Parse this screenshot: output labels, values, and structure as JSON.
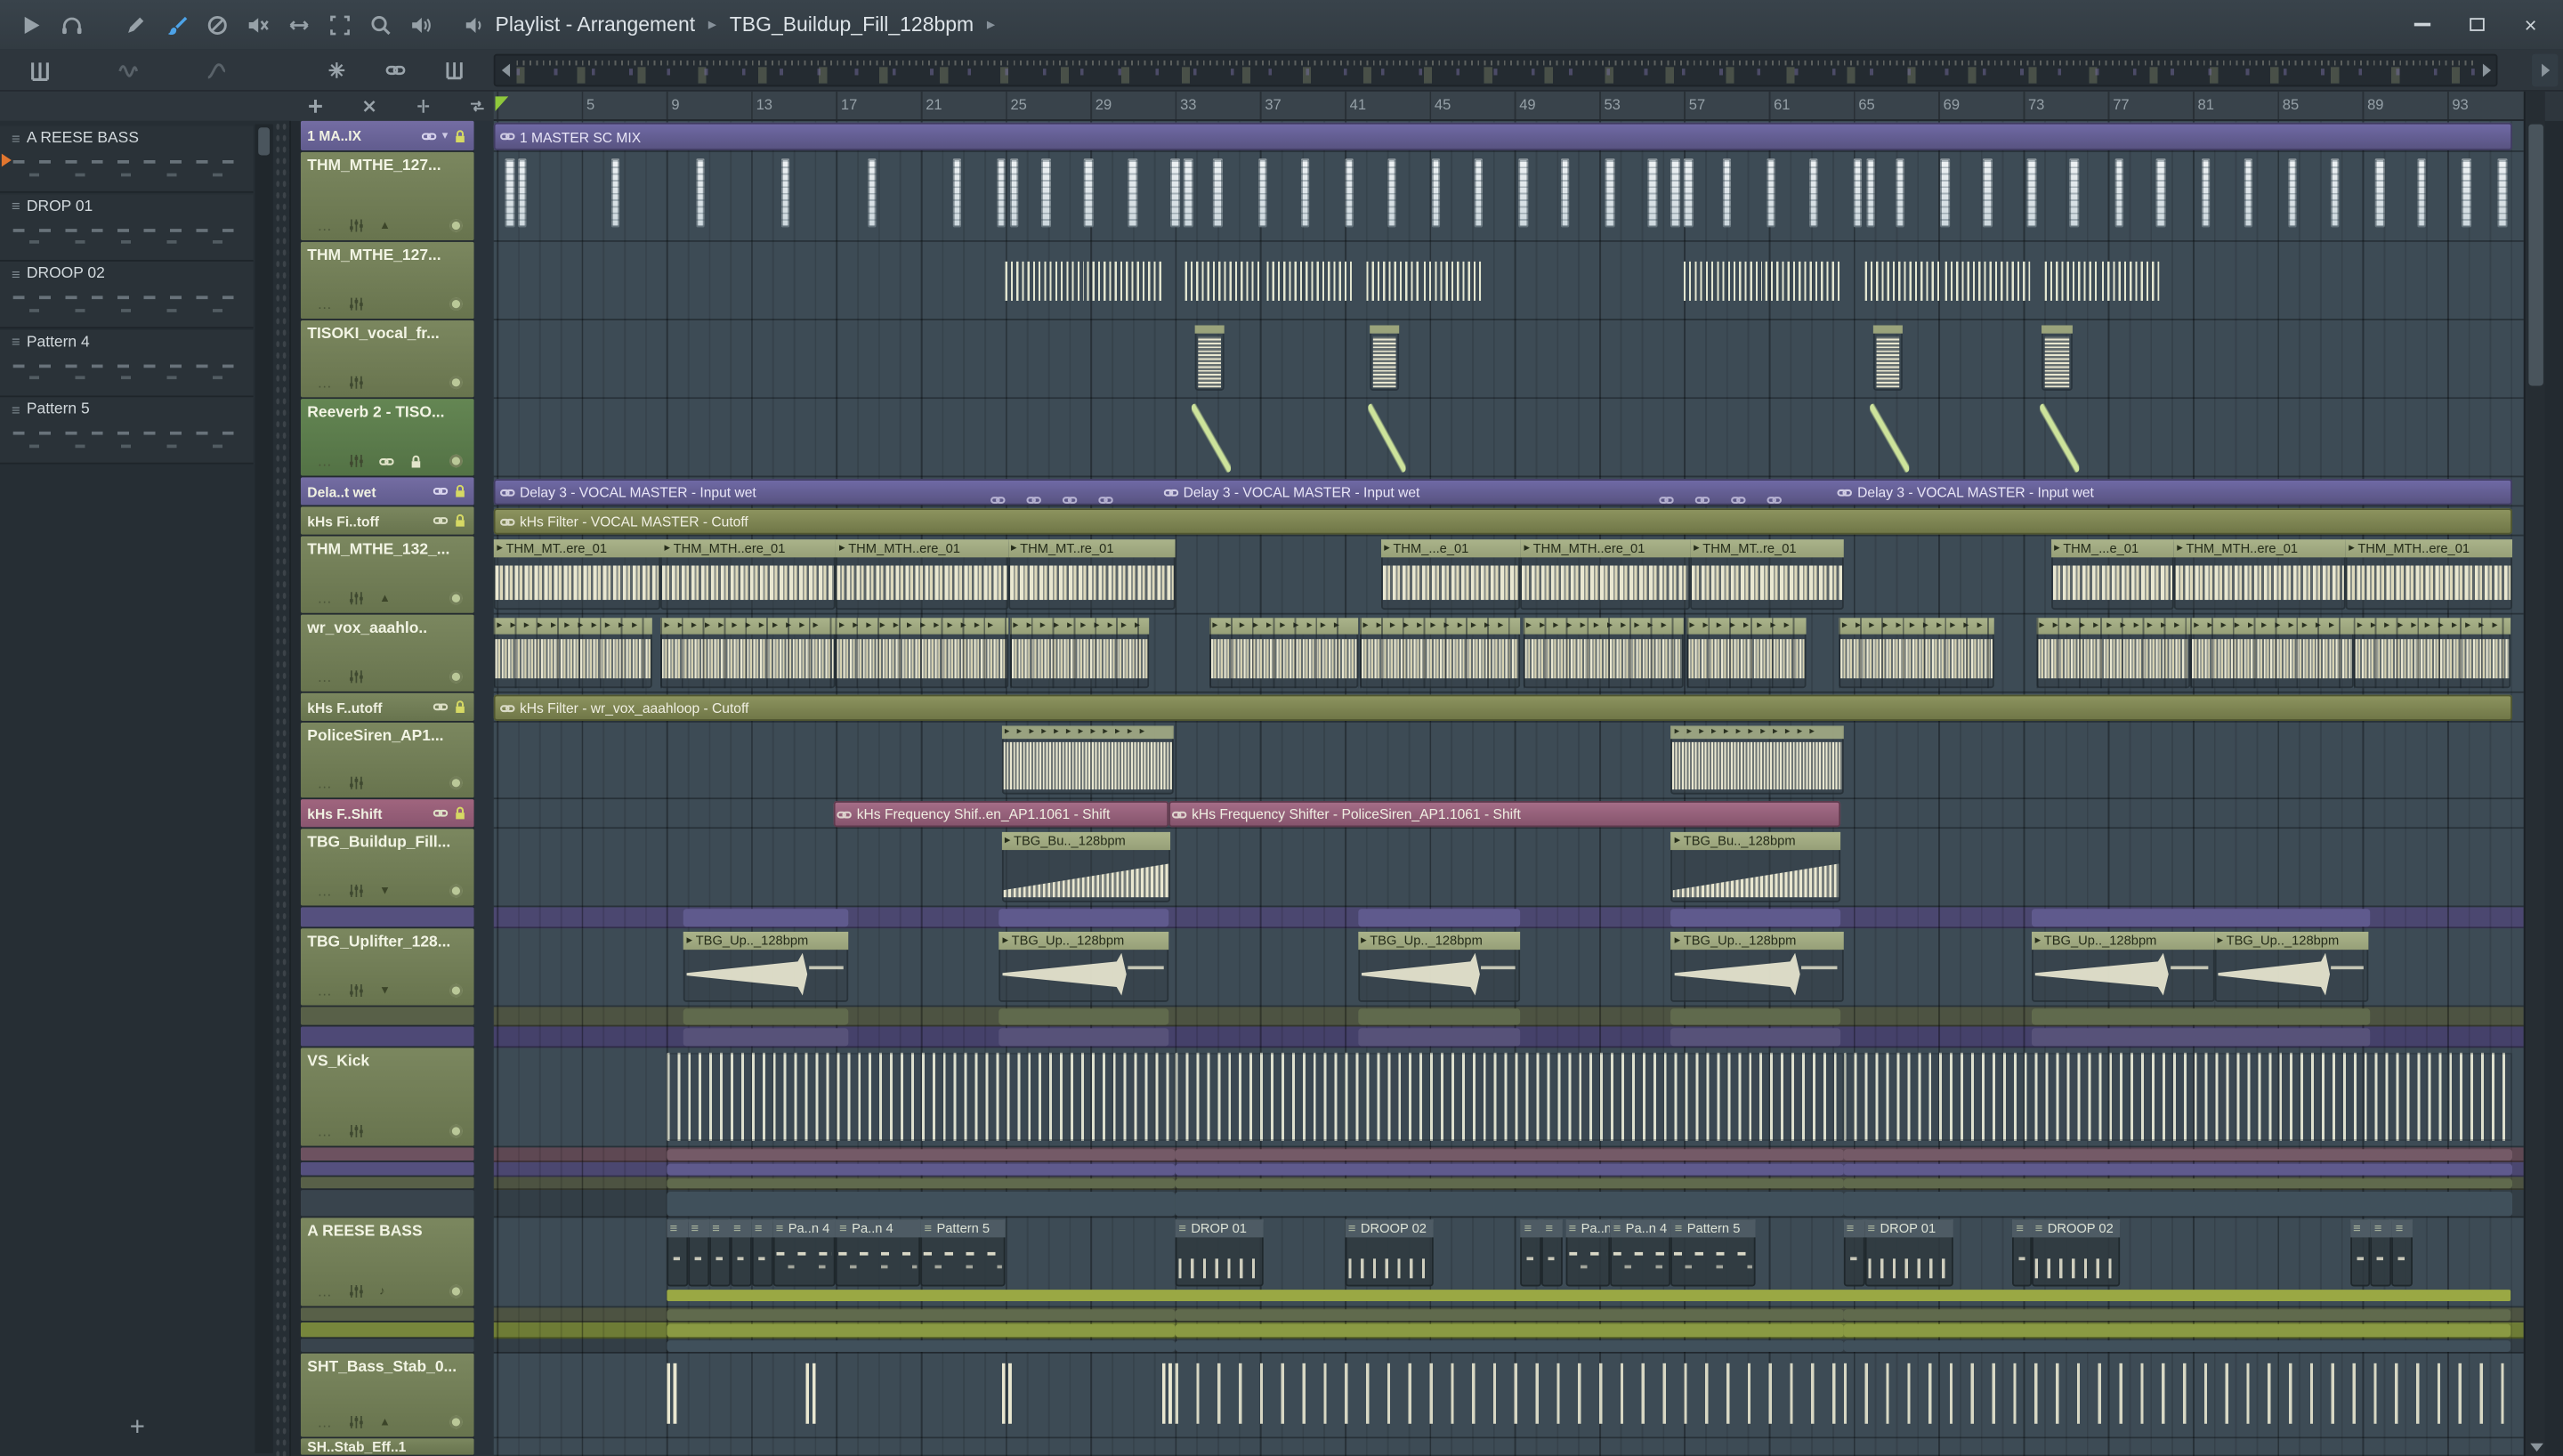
{
  "titlebar": {
    "breadcrumb": [
      "Playlist - Arrangement",
      "TBG_Buildup_Fill_128bpm"
    ],
    "tools": [
      "play",
      "headphones",
      "draw",
      "paint",
      "delete",
      "mute",
      "slide",
      "select",
      "zoom",
      "playback",
      "monitor"
    ],
    "window_controls": [
      "minimize",
      "maximize",
      "close"
    ]
  },
  "picker": {
    "items": [
      "A REESE BASS",
      "DROP 01",
      "DROOP 02",
      "Pattern 4",
      "Pattern 5"
    ],
    "active_index": 0,
    "add_button": "+"
  },
  "playlist_tools": {
    "row1": [
      "smart-find",
      "link",
      "track-mode"
    ],
    "row2": [
      "add",
      "delete",
      "slip",
      "swap"
    ]
  },
  "ruler": {
    "bar_numbers": [
      5,
      9,
      13,
      17,
      21,
      25,
      29,
      33,
      37,
      41,
      45,
      49,
      53,
      57,
      61,
      65,
      69,
      73,
      77,
      81,
      85,
      89,
      93
    ]
  },
  "tracks": [
    {
      "name": "1 MA..IX",
      "color": "purple",
      "h": 19,
      "small": true,
      "icons": [
        "link",
        "dropdown",
        "lock"
      ]
    },
    {
      "name": "THM_MTHE_127...",
      "color": "olive",
      "h": 55,
      "extra": "up"
    },
    {
      "name": "THM_MTHE_127...",
      "color": "olive",
      "h": 48
    },
    {
      "name": "TISOKI_vocal_fr...",
      "color": "olive",
      "h": 48
    },
    {
      "name": "Reeverb 2 - TISO...",
      "color": "green",
      "h": 48,
      "icons": [
        "link",
        "lock"
      ]
    },
    {
      "name": "Dela..t wet",
      "color": "purple",
      "h": 18,
      "small": true,
      "icons": [
        "link",
        "lock"
      ]
    },
    {
      "name": "kHs Fi..toff",
      "color": "olive",
      "h": 18,
      "small": true,
      "icons": [
        "link",
        "lock"
      ]
    },
    {
      "name": "THM_MTHE_132_...",
      "color": "olive",
      "h": 48,
      "extra": "up"
    },
    {
      "name": "wr_vox_aaahlo..",
      "color": "olive",
      "h": 48
    },
    {
      "name": "kHs F..utoff",
      "color": "olive",
      "h": 18,
      "small": true,
      "icons": [
        "link",
        "lock"
      ]
    },
    {
      "name": "PoliceSiren_AP1...",
      "color": "olive",
      "h": 47
    },
    {
      "name": "kHs F..Shift",
      "color": "pink",
      "h": 18,
      "small": true,
      "icons": [
        "link",
        "lock"
      ]
    },
    {
      "name": "TBG_Buildup_Fill...",
      "color": "olive",
      "h": 48,
      "extra": "down"
    },
    {
      "band": "purpleband",
      "h": 13
    },
    {
      "name": "TBG_Uplifter_128...",
      "color": "olive",
      "h": 48,
      "extra": "down"
    },
    {
      "band": "oliveband",
      "h": 12
    },
    {
      "band": "purpleband2",
      "h": 13
    },
    {
      "name": "VS_Kick",
      "color": "olive",
      "h": 61
    },
    {
      "band": "pinkband",
      "h": 9
    },
    {
      "band": "purpleband",
      "h": 9
    },
    {
      "band": "oliveband",
      "h": 8
    },
    {
      "band": "darkband",
      "h": 17
    },
    {
      "name": "A REESE BASS",
      "color": "olive",
      "h": 55,
      "extra": "note"
    },
    {
      "band": "oliveband",
      "h": 9
    },
    {
      "band": "limerow",
      "h": 10
    },
    {
      "band": "darkband",
      "h": 9
    },
    {
      "name": "SHT_Bass_Stab_0...",
      "color": "olive",
      "h": 52,
      "extra": "up"
    },
    {
      "name": "SH..Stab_Eff..1",
      "color": "olive",
      "h": 11,
      "small": true
    }
  ],
  "clips": [
    {
      "kind": "strip",
      "track": 0,
      "tone": "purple",
      "start": 0.85,
      "len": 95.25,
      "labels": [
        {
          "bar": 1.0,
          "text": "1 MASTER SC MIX"
        }
      ]
    },
    {
      "kind": "vset",
      "track": 1,
      "len": 0.42,
      "bars": [
        1.4,
        2.0,
        6.4,
        10.4,
        14.4,
        18.5,
        22.5,
        24.6,
        25.2,
        26.7,
        28.7,
        30.8,
        32.8,
        33.4,
        34.8,
        36.9,
        38.9,
        41.0,
        43.0,
        45.1,
        47.1,
        49.2,
        51.2,
        53.3,
        55.3,
        56.4,
        57.0,
        58.8,
        60.9,
        62.9,
        65.0,
        65.6,
        67.0,
        69.1,
        71.1,
        73.2,
        75.2,
        77.3,
        79.3,
        81.4,
        83.4,
        85.5,
        87.5,
        89.6,
        91.6,
        93.7,
        95.4
      ]
    },
    {
      "kind": "combset",
      "track": 2,
      "clips": [
        [
          25,
          3.7
        ],
        [
          28.8,
          3.6
        ],
        [
          33.5,
          3.6
        ],
        [
          37.3,
          4.0
        ],
        [
          42.0,
          2.6
        ],
        [
          44.7,
          2.7
        ],
        [
          57.0,
          3.7
        ],
        [
          60.8,
          3.6
        ],
        [
          65.5,
          3.6
        ],
        [
          69.3,
          4.0
        ],
        [
          74.0,
          2.6
        ],
        [
          76.7,
          2.7
        ]
      ]
    },
    {
      "kind": "oneshot",
      "track": 3,
      "len": 1.4,
      "bars": [
        33.9,
        42.2,
        65.9,
        73.9
      ]
    },
    {
      "kind": "curveset",
      "track": 4,
      "len": 1.8,
      "bars": [
        33.8,
        42.1,
        65.8,
        73.8
      ]
    },
    {
      "kind": "strip",
      "track": 5,
      "tone": "purple",
      "start": 0.85,
      "len": 95.25,
      "labels": [
        {
          "bar": 1.0,
          "text": "Delay 3 - VOCAL MASTER - Input wet"
        },
        {
          "bar": 32.3,
          "text": "Delay 3 - VOCAL MASTER - Input wet"
        },
        {
          "bar": 64.1,
          "text": "Delay 3 - VOCAL MASTER - Input wet"
        }
      ],
      "marks": [
        24.3,
        26.0,
        27.7,
        29.4,
        55.8,
        57.5,
        59.2,
        60.9
      ]
    },
    {
      "kind": "strip",
      "track": 6,
      "tone": "olive",
      "start": 0.85,
      "len": 95.25,
      "labels": [
        {
          "bar": 1.0,
          "text": "kHs Filter - VOCAL MASTER - Cutoff"
        }
      ]
    },
    {
      "kind": "audioset",
      "track": 7,
      "clips": [
        [
          0.85,
          7.9,
          "THM_MT..ere_01"
        ],
        [
          8.75,
          8.25,
          "THM_MTH..ere_01"
        ],
        [
          17.0,
          8.1,
          "THM_MTH..ere_01"
        ],
        [
          25.1,
          7.9,
          "THM_MT..re_01"
        ],
        [
          42.7,
          6.6,
          "THM_...e_01"
        ],
        [
          49.3,
          8.0,
          "THM_MTH..ere_01"
        ],
        [
          57.3,
          7.2,
          "THM_MT..re_01"
        ],
        [
          74.3,
          5.8,
          "THM_...e_01"
        ],
        [
          80.1,
          8.1,
          "THM_MTH..ere_01"
        ],
        [
          88.2,
          7.9,
          "THM_MTH..ere_01"
        ]
      ]
    },
    {
      "kind": "voxset",
      "track": 8,
      "clips": [
        [
          0.85,
          7.5
        ],
        [
          8.75,
          8.25
        ],
        [
          17.0,
          8.1
        ],
        [
          25.2,
          6.6
        ],
        [
          34.6,
          7.0
        ],
        [
          41.7,
          7.6
        ],
        [
          49.4,
          7.6
        ],
        [
          57.1,
          5.7
        ],
        [
          64.3,
          7.3
        ],
        [
          73.6,
          7.3
        ],
        [
          80.9,
          7.7
        ],
        [
          88.6,
          7.4
        ]
      ]
    },
    {
      "kind": "strip",
      "track": 9,
      "tone": "olive",
      "start": 0.85,
      "len": 95.25,
      "labels": [
        {
          "bar": 1.0,
          "text": "kHs Filter - wr_vox_aaahloop - Cutoff"
        }
      ]
    },
    {
      "kind": "policeset",
      "track": 10,
      "clips": [
        [
          24.8,
          8.1
        ],
        [
          56.4,
          8.1
        ]
      ]
    },
    {
      "kind": "pinkset",
      "track": 11,
      "clips": [
        [
          16.9,
          15.8,
          "kHs Frequency Shif..en_AP1.1061 - Shift"
        ],
        [
          32.7,
          31.7,
          "kHs Frequency Shifter - PoliceSiren_AP1.1061 - Shift"
        ]
      ]
    },
    {
      "kind": "buildupset",
      "track": 12,
      "label": "TBG_Bu.._128bpm",
      "clips": [
        [
          24.8,
          8.0
        ],
        [
          56.4,
          8.0
        ]
      ]
    },
    {
      "kind": "miniset",
      "track": 13,
      "clips": [
        [
          9.8,
          7.8
        ],
        [
          24.7,
          8.0
        ],
        [
          41.6,
          7.7
        ],
        [
          56.4,
          8.0
        ],
        [
          73.4,
          16.0
        ]
      ]
    },
    {
      "kind": "uplifterset",
      "track": 14,
      "label": "TBG_Up.._128bpm",
      "clips": [
        [
          9.8,
          7.8
        ],
        [
          24.7,
          8.0
        ],
        [
          41.6,
          7.7
        ],
        [
          56.4,
          8.1
        ],
        [
          73.4,
          8.6
        ],
        [
          82.0,
          7.3
        ]
      ]
    },
    {
      "kind": "miniset",
      "track": 15,
      "clips": [
        [
          9.8,
          7.8
        ],
        [
          24.7,
          8.0
        ],
        [
          41.6,
          7.7
        ],
        [
          56.4,
          8.0
        ],
        [
          73.4,
          16.0
        ]
      ]
    },
    {
      "kind": "miniset",
      "track": 16,
      "clips": [
        [
          9.8,
          7.8
        ],
        [
          24.7,
          8.0
        ],
        [
          41.6,
          7.7
        ],
        [
          56.4,
          8.0
        ],
        [
          73.4,
          16.0
        ]
      ]
    },
    {
      "kind": "kickset",
      "track": 17,
      "clips": [
        [
          9.0,
          24.0
        ],
        [
          33.0,
          31.5
        ],
        [
          64.5,
          31.6
        ]
      ]
    },
    {
      "kind": "miniset",
      "track": 18,
      "clips": [
        [
          9.0,
          24.0
        ],
        [
          33.0,
          31.5
        ],
        [
          64.5,
          31.6
        ]
      ]
    },
    {
      "kind": "miniset",
      "track": 19,
      "clips": [
        [
          9.0,
          24.0
        ],
        [
          33.0,
          31.5
        ],
        [
          64.5,
          31.6
        ]
      ]
    },
    {
      "kind": "miniset",
      "track": 20,
      "clips": [
        [
          9.0,
          24.0
        ],
        [
          33.0,
          31.5
        ],
        [
          64.5,
          31.6
        ]
      ]
    },
    {
      "kind": "miniset",
      "track": 21,
      "clips": [
        [
          9.0,
          24.0
        ],
        [
          33.0,
          31.5
        ],
        [
          64.5,
          31.6
        ]
      ]
    },
    {
      "kind": "patternset",
      "track": 22,
      "clips": [
        [
          9,
          1,
          ""
        ],
        [
          10,
          1,
          ""
        ],
        [
          11,
          1,
          ""
        ],
        [
          12,
          1,
          ""
        ],
        [
          13,
          1,
          ""
        ],
        [
          14,
          3,
          "Pa..n 4"
        ],
        [
          17,
          4,
          "Pa..n 4"
        ],
        [
          21,
          4,
          "Pattern 5"
        ],
        [
          33,
          4.2,
          "DROP 01"
        ],
        [
          41,
          4.2,
          "DROOP 02"
        ],
        [
          49.3,
          1,
          ""
        ],
        [
          50.3,
          1,
          ""
        ],
        [
          51.4,
          2.1,
          "Pa..n 4"
        ],
        [
          53.5,
          2.9,
          "Pa..n 4"
        ],
        [
          56.4,
          4,
          "Pattern 5"
        ],
        [
          64.5,
          1,
          ""
        ],
        [
          65.5,
          4.2,
          "DROP 01"
        ],
        [
          72.5,
          0.9,
          ""
        ],
        [
          73.4,
          4.2,
          "DROOP 02"
        ],
        [
          88.4,
          1,
          ""
        ],
        [
          89.4,
          1,
          ""
        ],
        [
          90.4,
          1,
          ""
        ]
      ]
    },
    {
      "kind": "limeband",
      "track": 22,
      "clips": [
        [
          9.0,
          87.0
        ]
      ]
    },
    {
      "kind": "miniset",
      "track": 23,
      "clips": [
        [
          9.0,
          24.0
        ],
        [
          33.0,
          31.5
        ],
        [
          64.5,
          31.5
        ]
      ]
    },
    {
      "kind": "miniset",
      "track": 24,
      "clips": [
        [
          9.0,
          24.0
        ],
        [
          33.0,
          31.5
        ],
        [
          64.5,
          31.5
        ]
      ]
    },
    {
      "kind": "miniset",
      "track": 25,
      "clips": [
        [
          9.0,
          24.0
        ],
        [
          33.0,
          31.5
        ],
        [
          64.5,
          31.5
        ]
      ]
    },
    {
      "kind": "stabset",
      "track": 26,
      "pairs": [
        9.0,
        15.6,
        24.8,
        32.4
      ],
      "combs": [
        [
          33.0,
          31.5
        ],
        [
          64.5,
          31.5
        ]
      ]
    }
  ]
}
